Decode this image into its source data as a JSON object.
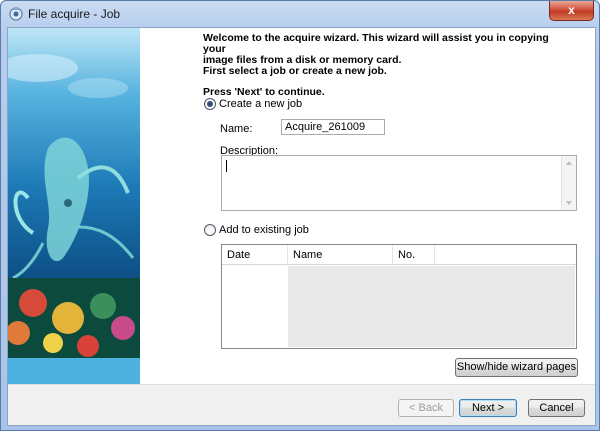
{
  "window": {
    "title": "File acquire - Job",
    "close_glyph": "x"
  },
  "intro": {
    "line1": "Welcome to the acquire wizard. This wizard will assist you in copying your",
    "line2": "image files from a disk or memory card.",
    "line3": "First select a job or create a new job.",
    "continue": "Press 'Next' to continue."
  },
  "create_new": {
    "label": "Create a new job",
    "selected": true,
    "name_label": "Name:",
    "name_value": "Acquire_261009",
    "description_label": "Description:",
    "description_value": ""
  },
  "existing": {
    "label": "Add to existing job",
    "selected": false,
    "columns": [
      "Date",
      "Name",
      "No. files"
    ]
  },
  "buttons": {
    "show_hide": "Show/hide wizard pages ...",
    "back": "< Back",
    "next": "Next >",
    "cancel": "Cancel"
  },
  "icons": {
    "app": "camera-app-icon",
    "banner": "underwater-coral-photo"
  }
}
